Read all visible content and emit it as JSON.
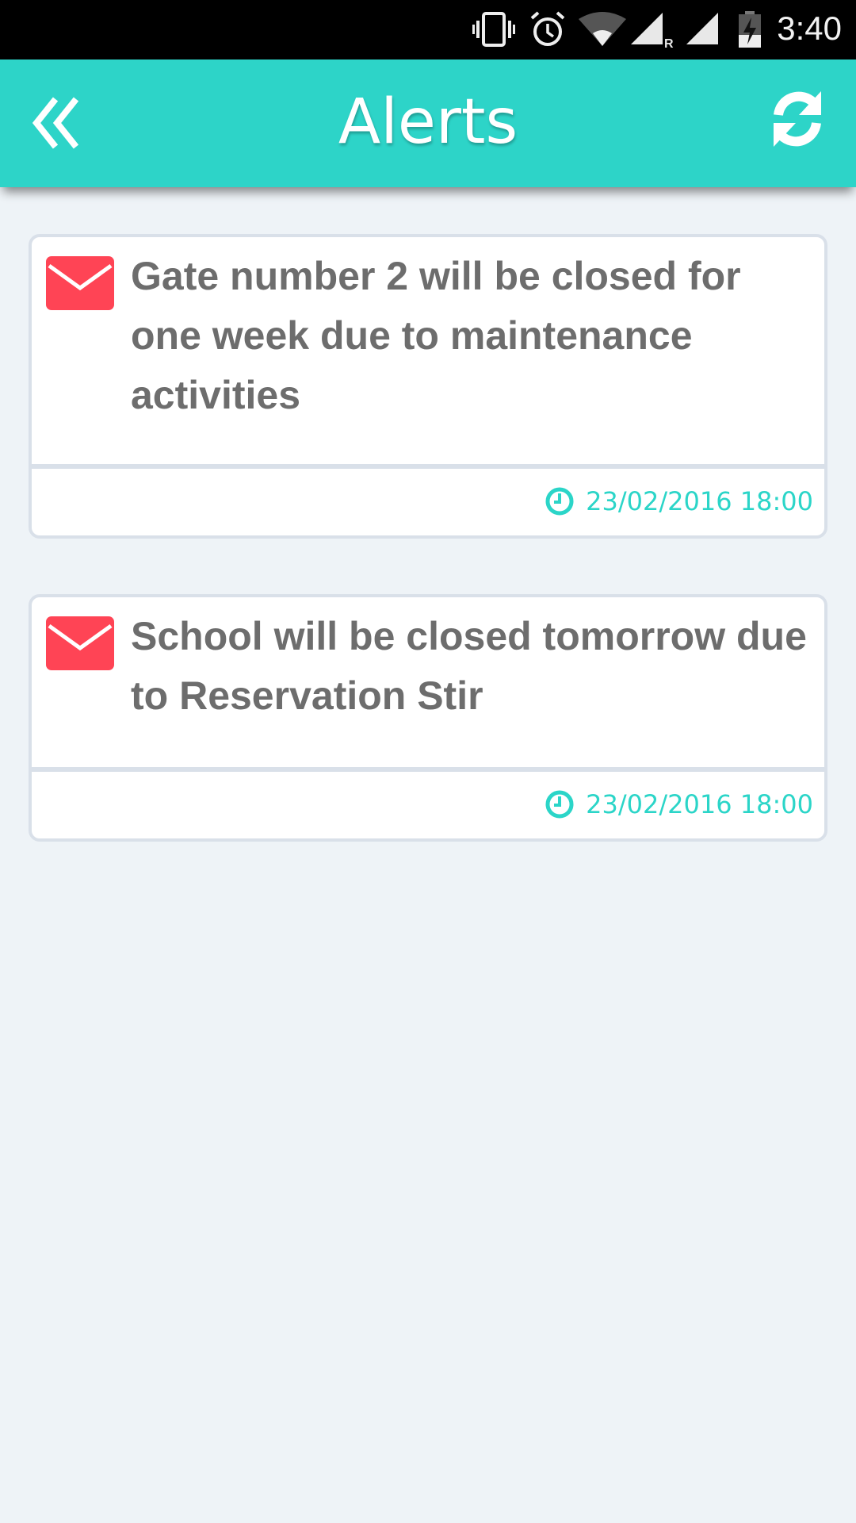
{
  "status_bar": {
    "time": "3:40",
    "icons": [
      "vibrate-icon",
      "alarm-icon",
      "wifi-icon",
      "signal-roaming-icon",
      "signal-icon",
      "battery-charging-icon"
    ]
  },
  "header": {
    "title": "Alerts",
    "back_icon": "double-chevron-left-icon",
    "refresh_icon": "refresh-icon"
  },
  "colors": {
    "accent": "#2dd4c8",
    "envelope": "#ff4455",
    "text": "#6d6d6d",
    "background": "#eef3f7"
  },
  "alerts": [
    {
      "message": "Gate number 2 will be closed for one week due to maintenance activities",
      "timestamp": "23/02/2016 18:00",
      "icon": "envelope-icon"
    },
    {
      "message": "School will be closed tomorrow due to Reservation Stir",
      "timestamp": "23/02/2016 18:00",
      "icon": "envelope-icon"
    }
  ]
}
